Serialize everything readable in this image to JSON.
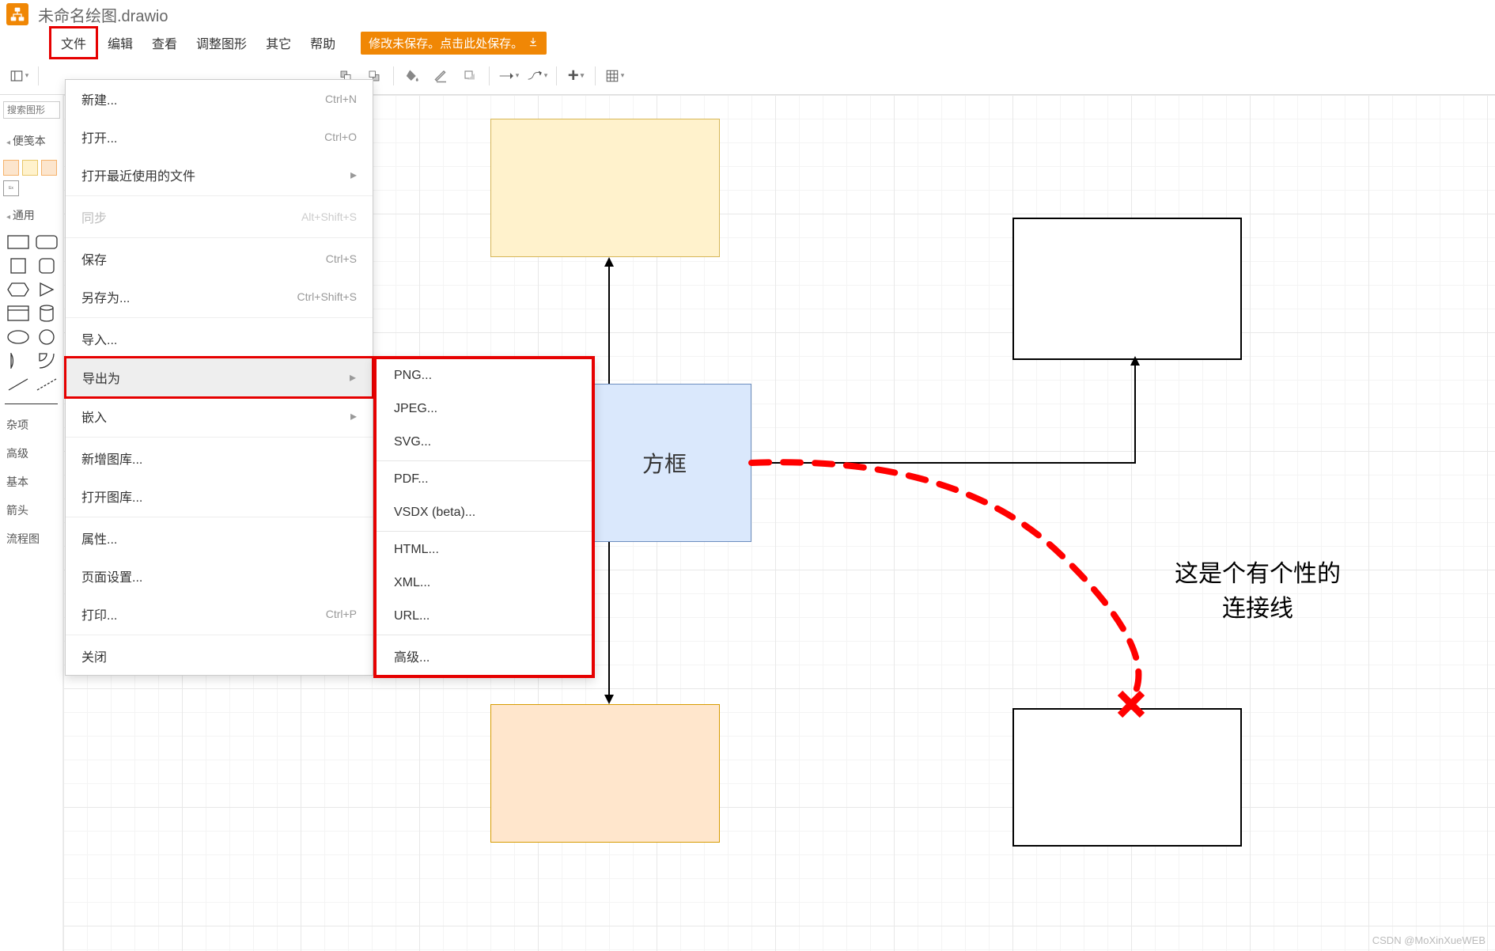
{
  "header": {
    "title": "未命名绘图.drawio"
  },
  "menubar": {
    "items": [
      "文件",
      "编辑",
      "查看",
      "调整图形",
      "其它",
      "帮助"
    ],
    "save_banner": "修改未保存。点击此处保存。",
    "active_index": 0
  },
  "sidebar": {
    "search_placeholder": "搜索图形",
    "sections": {
      "notes": "便笺本",
      "general": "通用",
      "misc": "杂项",
      "advanced": "高级",
      "basic": "基本",
      "arrow": "箭头",
      "flowchart": "流程图"
    }
  },
  "file_menu": {
    "items": [
      {
        "label": "新建...",
        "shortcut": "Ctrl+N"
      },
      {
        "label": "打开...",
        "shortcut": "Ctrl+O"
      },
      {
        "label": "打开最近使用的文件",
        "submenu": true
      },
      {
        "label": "同步",
        "shortcut": "Alt+Shift+S",
        "disabled": true
      },
      {
        "label": "保存",
        "shortcut": "Ctrl+S"
      },
      {
        "label": "另存为...",
        "shortcut": "Ctrl+Shift+S"
      },
      {
        "label": "导入..."
      },
      {
        "label": "导出为",
        "submenu": true,
        "highlight": true,
        "hovered": true
      },
      {
        "label": "嵌入",
        "submenu": true
      },
      {
        "label": "新增图库..."
      },
      {
        "label": "打开图库..."
      },
      {
        "label": "属性..."
      },
      {
        "label": "页面设置..."
      },
      {
        "label": "打印...",
        "shortcut": "Ctrl+P"
      },
      {
        "label": "关闭"
      }
    ],
    "separators_after": [
      2,
      3,
      5,
      8,
      10,
      13
    ]
  },
  "export_menu": {
    "items": [
      "PNG...",
      "JPEG...",
      "SVG...",
      "PDF...",
      "VSDX (beta)...",
      "HTML...",
      "XML...",
      "URL...",
      "高级..."
    ],
    "separators_after": [
      2,
      4,
      7
    ]
  },
  "canvas": {
    "blue_box_label": "方框",
    "annotation_line1": "这是个有个性的",
    "annotation_line2": "连接线"
  },
  "watermark": "CSDN @MoXinXueWEB",
  "icons": {
    "download": "download-icon",
    "submenu_arrow": "▸"
  },
  "colors": {
    "brand": "#f08705",
    "highlight": "#e60000",
    "dash_red": "#ff0000"
  }
}
